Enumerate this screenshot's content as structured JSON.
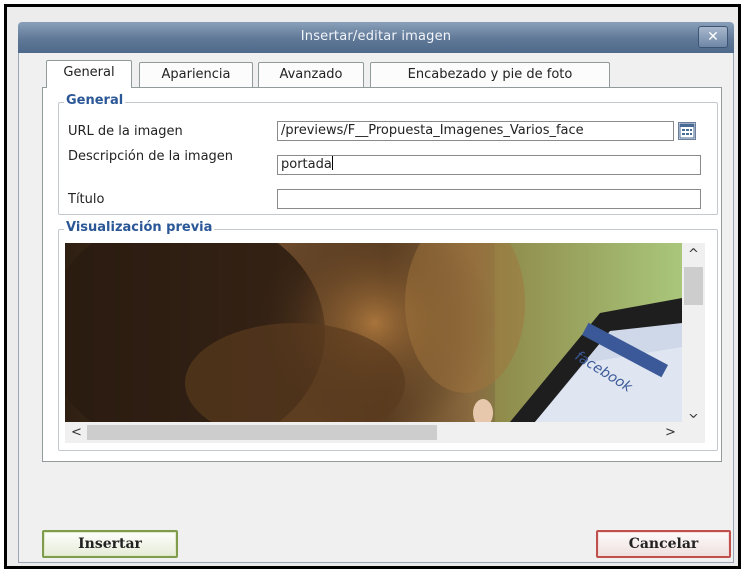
{
  "dialog": {
    "title": "Insertar/editar imagen",
    "close_label": "✕"
  },
  "tabs": [
    {
      "label": "General",
      "active": true
    },
    {
      "label": "Apariencia",
      "active": false
    },
    {
      "label": "Avanzado",
      "active": false
    },
    {
      "label": "Encabezado y pie de foto",
      "active": false
    }
  ],
  "general": {
    "legend": "General",
    "url_label": "URL de la imagen",
    "url_value": "/previews/F__Propuesta_Imagenes_Varios_face",
    "description_label": "Descripción de la imagen",
    "description_value": "portada",
    "title_label": "Título",
    "title_value": ""
  },
  "preview": {
    "legend": "Visualización previa",
    "image_text": "facebook"
  },
  "buttons": {
    "insert": "Insertar",
    "cancel": "Cancelar"
  },
  "icons": {
    "browse": "browse-icon",
    "scroll_up": "chevron-up-icon",
    "scroll_down": "chevron-down-icon",
    "scroll_left": "chevron-left-icon",
    "scroll_right": "chevron-right-icon"
  },
  "colors": {
    "titlebar": "#5f7896",
    "legend": "#2b5797",
    "insert_border": "#7f9c4d",
    "cancel_border": "#c0504d"
  }
}
